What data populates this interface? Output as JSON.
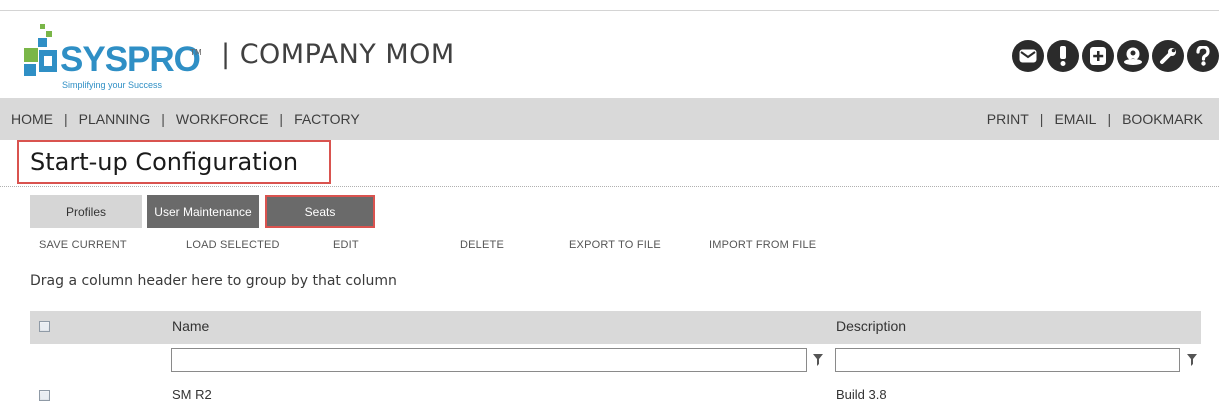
{
  "logo": {
    "wordmark": "SYSPRO",
    "trademark": "TM",
    "tagline": "Simplifying your Success"
  },
  "app_title": "COMPANY MOM",
  "header_icons": [
    "mail-icon",
    "alert-icon",
    "add-document-icon",
    "user-icon",
    "wrench-icon",
    "help-icon"
  ],
  "nav": {
    "left": [
      "HOME",
      "PLANNING",
      "WORKFORCE",
      "FACTORY"
    ],
    "right": [
      "PRINT",
      "EMAIL",
      "BOOKMARK"
    ],
    "separator": "|"
  },
  "page_title": "Start-up Configuration",
  "tabs": {
    "profiles": "Profiles",
    "user_maintenance": "User Maintenance",
    "seats": "Seats"
  },
  "actions": {
    "save_current": "SAVE CURRENT",
    "load_selected": "LOAD SELECTED",
    "edit": "EDIT",
    "delete": "DELETE",
    "export": "EXPORT TO FILE",
    "import": "IMPORT FROM FILE"
  },
  "group_hint": "Drag a column header here to group by that column",
  "grid": {
    "columns": {
      "name": "Name",
      "description": "Description"
    },
    "filters": {
      "name": "",
      "description": ""
    },
    "rows": [
      {
        "name": "SM R2",
        "description": "Build 3.8"
      }
    ]
  },
  "colors": {
    "accent_red": "#d9534f",
    "brand_blue": "#2f8fc5",
    "nav_bg": "#d9d9d9",
    "tab_dark": "#6a6a6a"
  }
}
